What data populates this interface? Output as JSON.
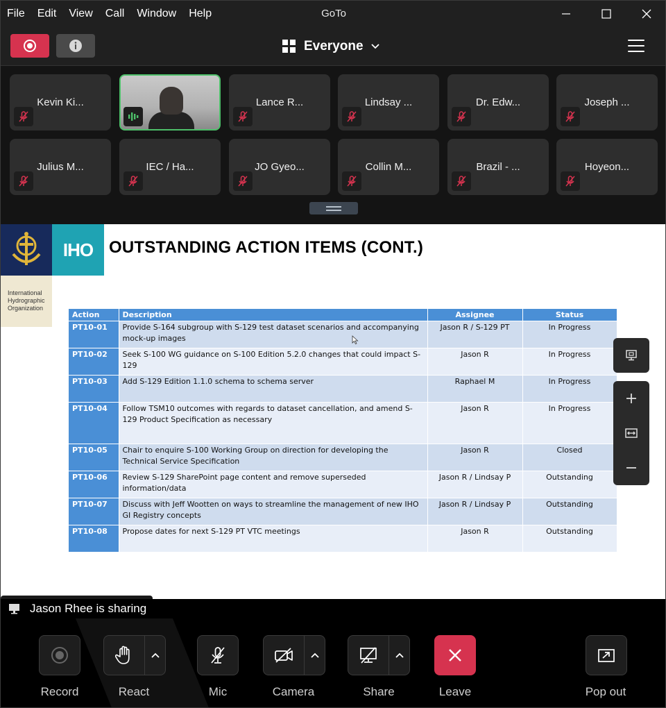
{
  "window": {
    "title": "GoTo",
    "menu": [
      "File",
      "Edit",
      "View",
      "Call",
      "Window",
      "Help"
    ]
  },
  "topbar": {
    "view_label": "Everyone"
  },
  "participants": [
    {
      "name": "Kevin Ki...",
      "muted": true
    },
    {
      "name": "",
      "muted": false,
      "video": true,
      "speaking": true
    },
    {
      "name": "Lance R...",
      "muted": true
    },
    {
      "name": "Lindsay ...",
      "muted": true
    },
    {
      "name": "Dr. Edw...",
      "muted": true
    },
    {
      "name": "Joseph ...",
      "muted": true
    },
    {
      "name": "Julius M...",
      "muted": true
    },
    {
      "name": "IEC / Ha...",
      "muted": true
    },
    {
      "name": "JO Gyeo...",
      "muted": true
    },
    {
      "name": "Collin M...",
      "muted": true
    },
    {
      "name": "Brazil - ...",
      "muted": true
    },
    {
      "name": "Hoyeon...",
      "muted": true
    }
  ],
  "slide": {
    "logo_text": "IHO",
    "org_name": [
      "International",
      "Hydrographic",
      "Organization"
    ],
    "title": "OUTSTANDING ACTION ITEMS (CONT.)",
    "headers": {
      "action": "Action",
      "description": "Description",
      "assignee": "Assignee",
      "status": "Status"
    },
    "rows": [
      {
        "action": "PT10-01",
        "description": "Provide S-164 subgroup with S-129 test dataset scenarios and accompanying mock-up images",
        "assignee": "Jason R / S-129 PT",
        "status": "In Progress"
      },
      {
        "action": "PT10-02",
        "description": "Seek S-100 WG guidance on S-100 Edition 5.2.0 changes that could impact S-129",
        "assignee": "Jason R",
        "status": "In Progress"
      },
      {
        "action": "PT10-03",
        "description": "Add S-129 Edition 1.1.0 schema to schema server",
        "assignee": "Raphael M",
        "status": "In Progress"
      },
      {
        "action": "PT10-04",
        "description": "Follow TSM10 outcomes with regards to dataset cancellation, and amend S-129 Product Specification as necessary",
        "assignee": "Jason R",
        "status": "In Progress"
      },
      {
        "action": "PT10-05",
        "description": "Chair to enquire S-100 Working Group on direction for developing the Technical Service Specification",
        "assignee": "Jason R",
        "status": "Closed"
      },
      {
        "action": "PT10-06",
        "description": "Review S-129 SharePoint page content and remove superseded information/data",
        "assignee": "Jason R / Lindsay P",
        "status": "Outstanding"
      },
      {
        "action": "PT10-07",
        "description": "Discuss with Jeff Wootten on ways to streamline the management of new IHO GI Registry concepts",
        "assignee": "Jason R / Lindsay P",
        "status": "Outstanding"
      },
      {
        "action": "PT10-08",
        "description": "Propose dates for next S-129 PT VTC meetings",
        "assignee": "Jason R",
        "status": "Outstanding"
      }
    ]
  },
  "sharing": {
    "status_text": "Jason Rhee is sharing"
  },
  "toolbar": {
    "record": "Record",
    "react": "React",
    "mic": "Mic",
    "camera": "Camera",
    "share": "Share",
    "leave": "Leave",
    "popout": "Pop out"
  },
  "colors": {
    "record_accent": "#d6334f",
    "speaking_border": "#4ec06a",
    "table_header": "#4a8fd6",
    "iho_navy": "#172a5b",
    "iho_teal": "#1fa3b3"
  }
}
